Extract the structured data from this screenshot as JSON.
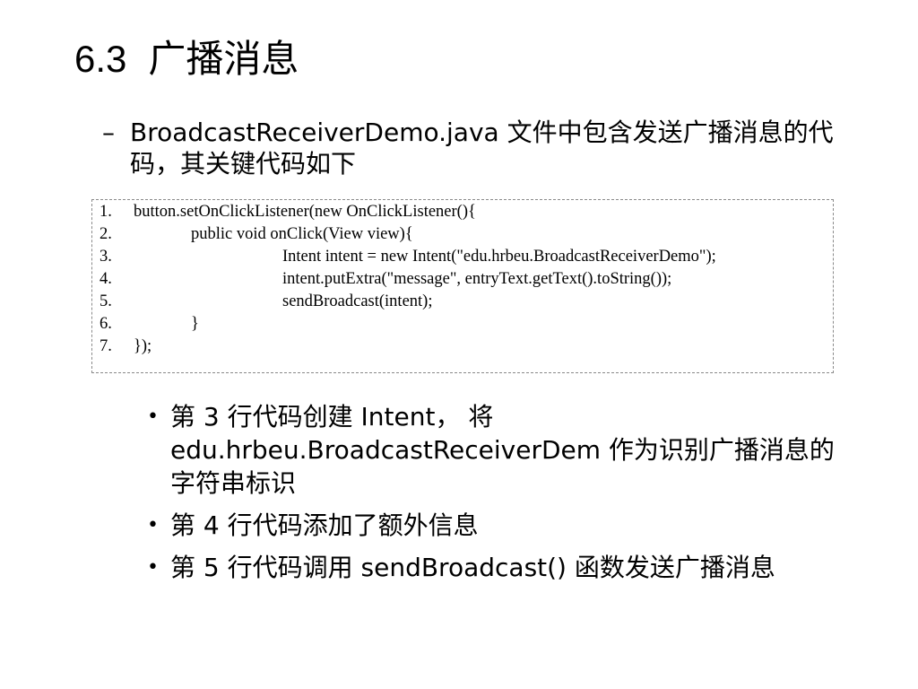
{
  "slide": {
    "title_number": "6.3",
    "title_text": "广播消息",
    "intro_dash": "–",
    "intro_text": "BroadcastReceiverDemo.java 文件中包含发送广播消息的代码，其关键代码如下"
  },
  "code": {
    "lines": [
      {
        "num": "1.",
        "text": "button.setOnClickListener(new OnClickListener(){"
      },
      {
        "num": "2.",
        "text": "public void onClick(View view){"
      },
      {
        "num": "3.",
        "text": "Intent intent = new Intent(\"edu.hrbeu.BroadcastReceiverDemo\");"
      },
      {
        "num": "4.",
        "text": "intent.putExtra(\"message\", entryText.getText().toString());"
      },
      {
        "num": "5.",
        "text": "sendBroadcast(intent);"
      },
      {
        "num": "6.",
        "text": "}"
      },
      {
        "num": "7.",
        "text": "});"
      }
    ]
  },
  "bullets": {
    "marker": "•",
    "items": [
      {
        "text": "第 3 行代码创建 Intent， 将 edu.hrbeu.BroadcastReceiverDem 作为识别广播消息的字符串标识"
      },
      {
        "text": "第 4 行代码添加了额外信息"
      },
      {
        "text": "第 5 行代码调用 sendBroadcast() 函数发送广播消息"
      }
    ]
  }
}
